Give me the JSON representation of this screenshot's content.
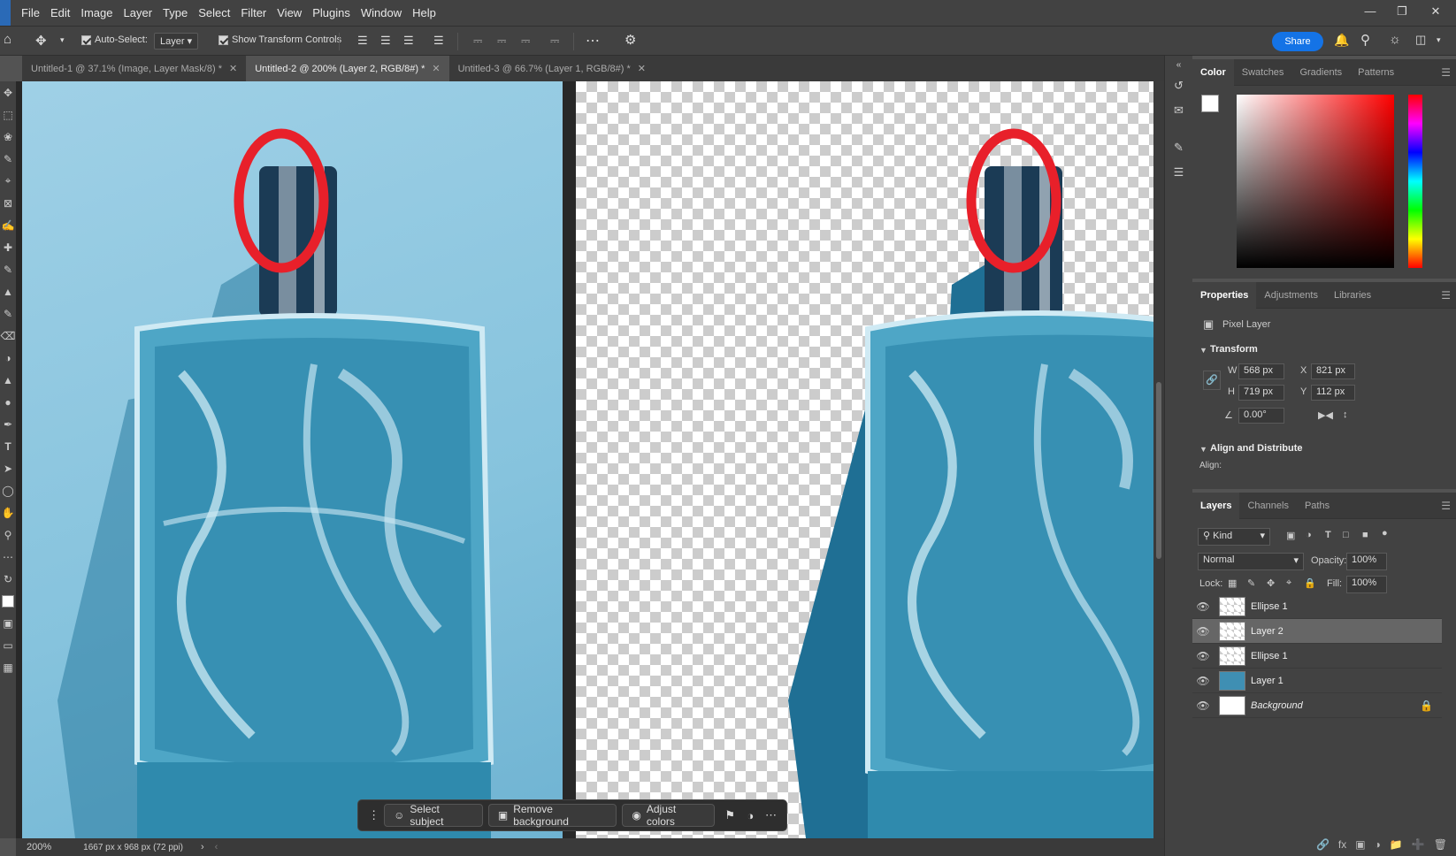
{
  "menubar": {
    "items": [
      "File",
      "Edit",
      "Image",
      "Layer",
      "Type",
      "Select",
      "Filter",
      "View",
      "Plugins",
      "Window",
      "Help"
    ]
  },
  "options": {
    "auto_select_label": "Auto-Select:",
    "auto_select_value": "Layer",
    "show_transform_label": "Show Transform Controls",
    "share_label": "Share"
  },
  "tabs": [
    {
      "label": "Untitled-1 @ 37.1% (Image, Layer Mask/8) *"
    },
    {
      "label": "Untitled-2 @ 200% (Layer 2, RGB/8#) *"
    },
    {
      "label": "Untitled-3 @ 66.7% (Layer 1, RGB/8#) *"
    }
  ],
  "status": {
    "zoom": "200%",
    "doc_info": "1667 px x 968 px (72 ppi)"
  },
  "contextbar": {
    "select_subject": "Select subject",
    "remove_background": "Remove background",
    "adjust_colors": "Adjust colors"
  },
  "color_panel": {
    "tabs": [
      "Color",
      "Swatches",
      "Gradients",
      "Patterns"
    ]
  },
  "properties_panel": {
    "tabs": [
      "Properties",
      "Adjustments",
      "Libraries"
    ],
    "layer_type": "Pixel Layer",
    "transform_title": "Transform",
    "w_label": "W",
    "w_value": "568 px",
    "h_label": "H",
    "h_value": "719 px",
    "x_label": "X",
    "x_value": "821 px",
    "y_label": "Y",
    "y_value": "112 px",
    "angle_value": "0.00°",
    "align_title": "Align and Distribute",
    "align_label": "Align:"
  },
  "layers_panel": {
    "tabs": [
      "Layers",
      "Channels",
      "Paths"
    ],
    "kind_label": "Kind",
    "blend_mode": "Normal",
    "opacity_label": "Opacity:",
    "opacity_value": "100%",
    "lock_label": "Lock:",
    "fill_label": "Fill:",
    "fill_value": "100%",
    "layers": [
      {
        "name": "Ellipse 1"
      },
      {
        "name": "Layer 2"
      },
      {
        "name": "Ellipse 1"
      },
      {
        "name": "Layer 1"
      },
      {
        "name": "Background"
      }
    ]
  },
  "colors": {
    "accent": "#1473e6",
    "annotation_red": "#e8202a"
  }
}
